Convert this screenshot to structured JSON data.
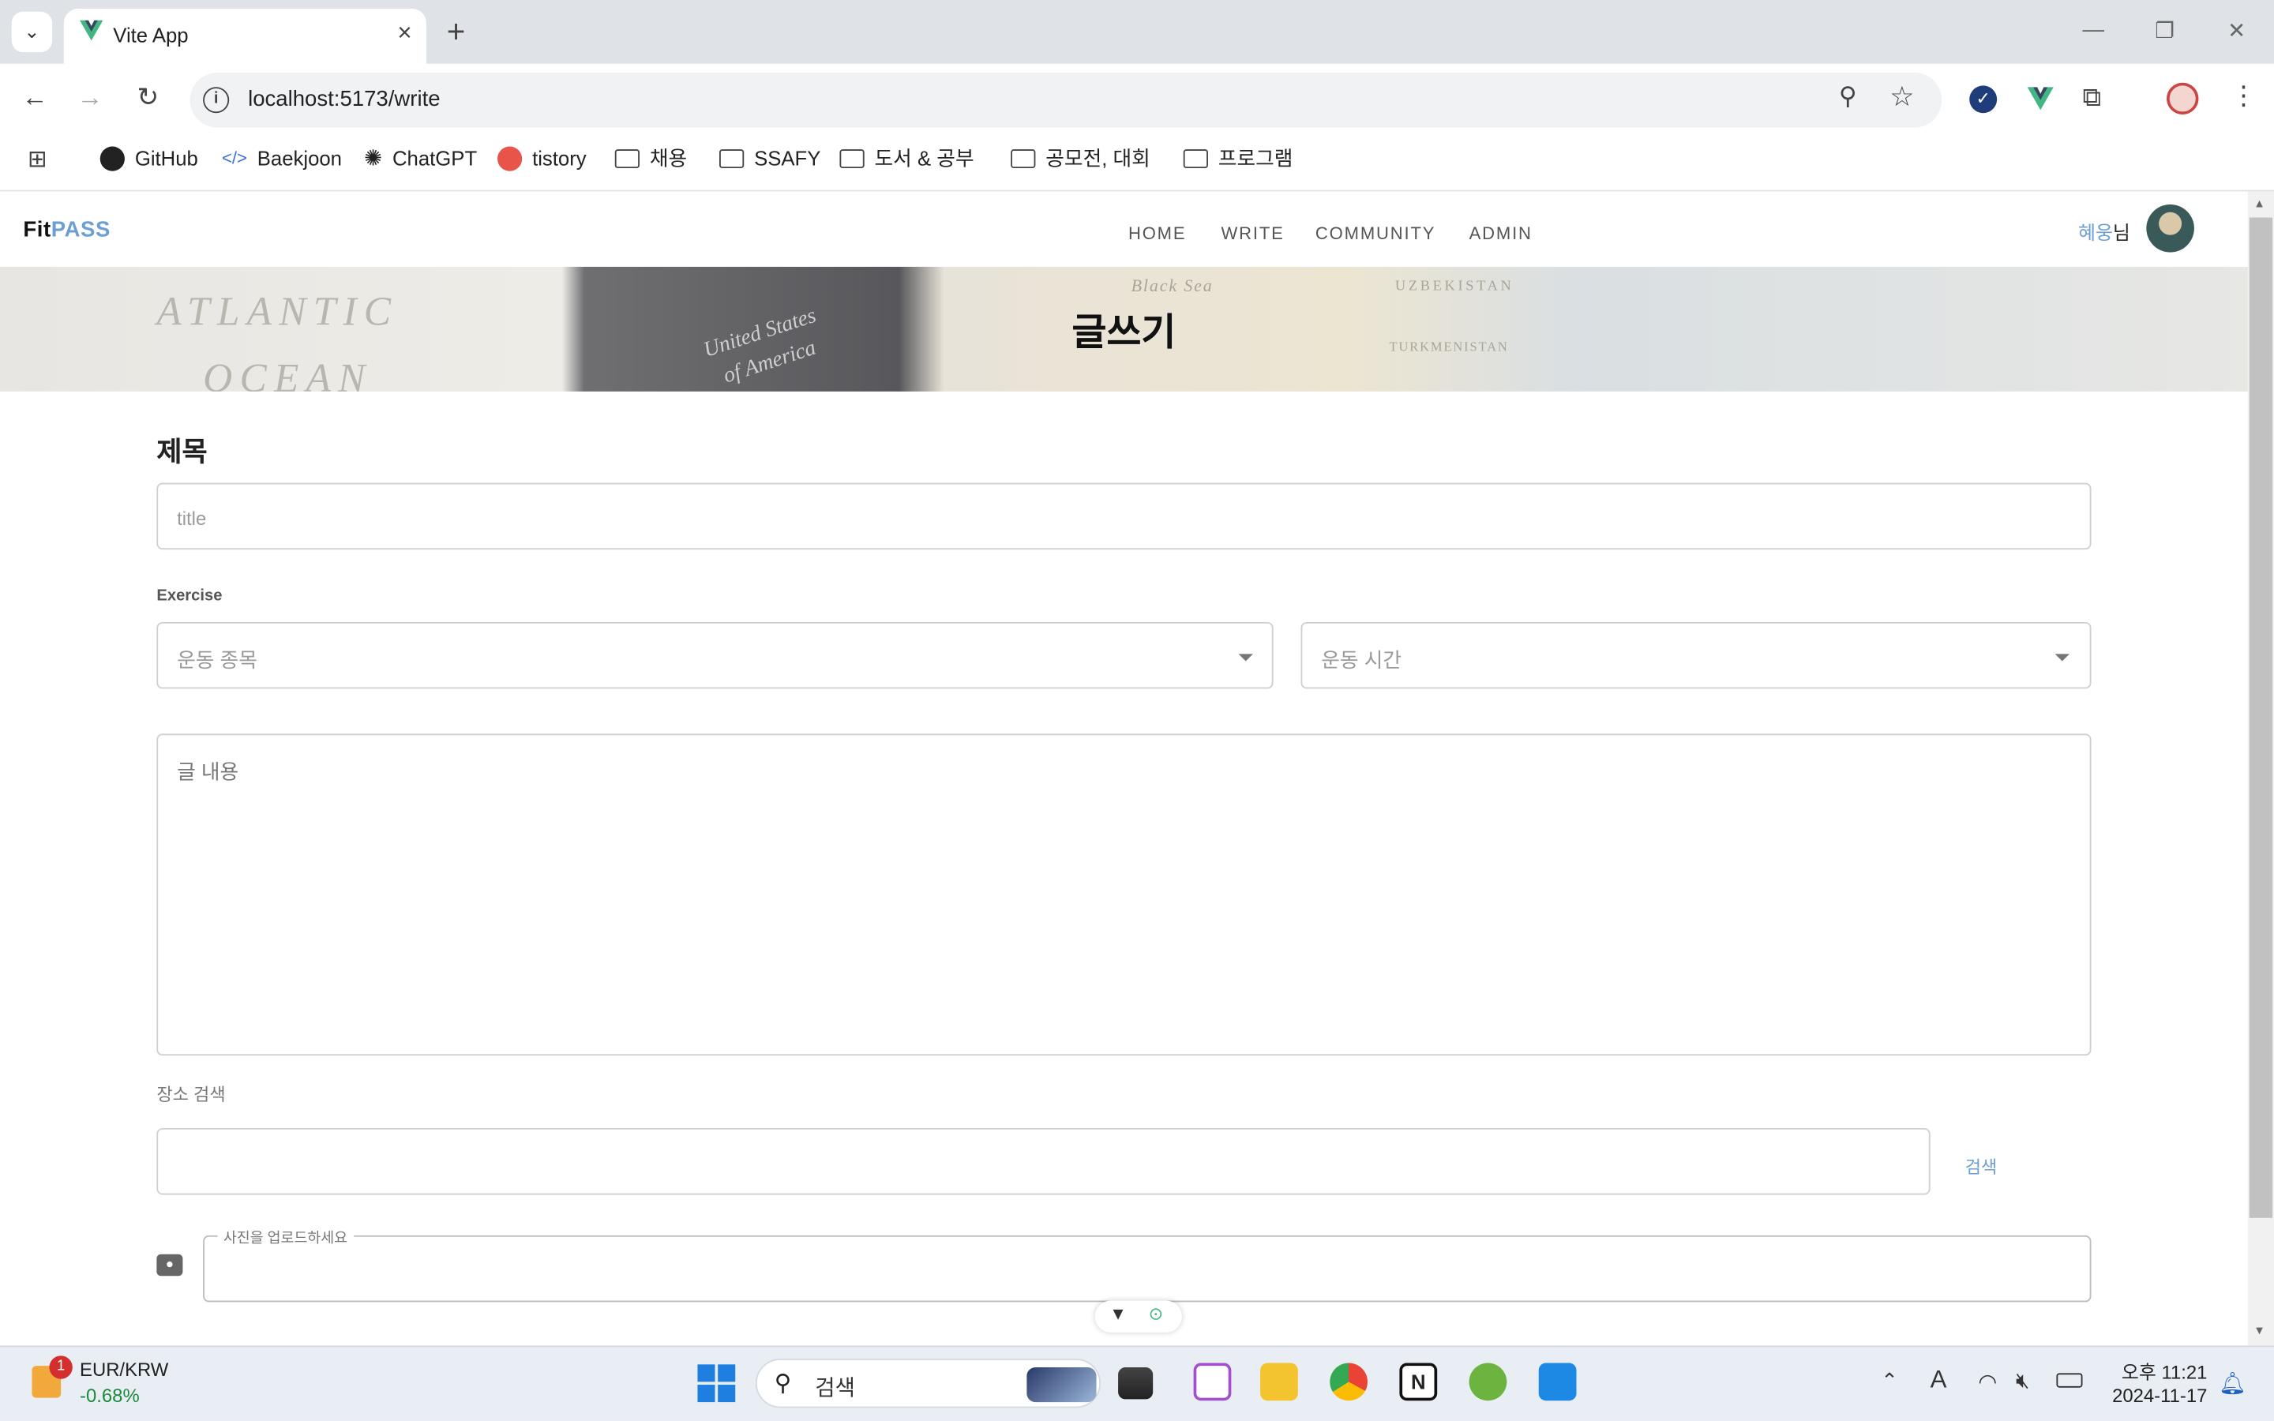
{
  "browser": {
    "tab_title": "Vite App",
    "url": "localhost:5173/write",
    "bookmarks": [
      "GitHub",
      "Baekjoon",
      "ChatGPT",
      "tistory",
      "채용",
      "SSAFY",
      "도서 & 공부",
      "공모전, 대회",
      "프로그램"
    ]
  },
  "app": {
    "logo_fit": "Fit",
    "logo_pass": "PASS",
    "nav": [
      "HOME",
      "WRITE",
      "COMMUNITY",
      "ADMIN"
    ],
    "user_name": "혜웅",
    "user_suffix": "님",
    "hero_title": "글쓰기",
    "hero_words": [
      "ATLANTIC",
      "OCEAN",
      "United States",
      "of America",
      "Black Sea",
      "UZBEKISTAN",
      "TURKMENISTAN"
    ]
  },
  "form": {
    "title_label": "제목",
    "title_placeholder": "title",
    "exercise_label": "Exercise",
    "exercise_type_placeholder": "운동 종목",
    "exercise_time_placeholder": "운동 시간",
    "content_placeholder": "글 내용",
    "place_label": "장소 검색",
    "search_button": "검색",
    "photo_label": "사진을 업로드하세요"
  },
  "taskbar": {
    "ticker_badge": "1",
    "ticker_name": "EUR/KRW",
    "ticker_change": "-0.68%",
    "search_placeholder": "검색",
    "time": "오후 11:21",
    "date": "2024-11-17"
  },
  "colors": {
    "accent": "#6b9fd4",
    "ticker_down": "#1a8a3a"
  }
}
